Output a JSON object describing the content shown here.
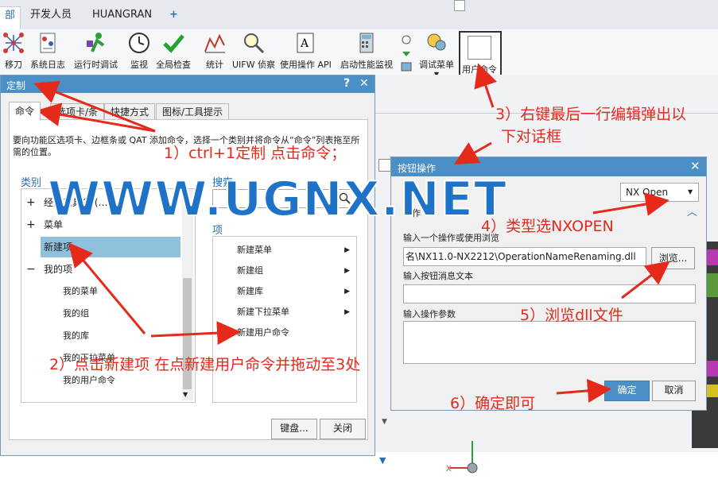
{
  "ribbon_tabs": [
    "部",
    "开发人员",
    "HUANGRAN",
    "+"
  ],
  "ribbon_buttons": [
    {
      "label": "移刀",
      "icon": "network-icon"
    },
    {
      "label": "系统日志",
      "icon": "log-icon"
    },
    {
      "label": "运行时调试",
      "icon": "debug-run-icon"
    },
    {
      "label": "监视",
      "icon": "clock-icon"
    },
    {
      "label": "全局检查",
      "icon": "check-icon"
    },
    {
      "label": "统计",
      "icon": "chart-icon"
    },
    {
      "label": "UIFW 侦察",
      "icon": "magnifier-icon"
    },
    {
      "label": "使用操作 API",
      "icon": "api-doc-icon"
    },
    {
      "label": "启动性能监视",
      "icon": "calculator-icon"
    },
    {
      "label": "调试菜单",
      "icon": "debug-menu-icon"
    },
    {
      "label": "用户命令",
      "icon": "blank-command-icon"
    }
  ],
  "customize": {
    "title": "定制",
    "help": "?",
    "close": "✕",
    "tabs": [
      "命令",
      "选项卡/条",
      "快捷方式",
      "图标/工具提示"
    ],
    "description": "要向功能区选项卡、边框条或 QAT 添加命令，选择一个类别并将命令从“命令”列表拖至所需的位置。",
    "category_heading": "类别",
    "search_heading": "搜索",
    "items_heading": "项",
    "tree": [
      {
        "label": "经典工具条 (…",
        "indent": 1,
        "expander": "+"
      },
      {
        "label": "菜单",
        "indent": 1,
        "expander": "+"
      },
      {
        "label": "新建项",
        "indent": 1,
        "expander": ""
      },
      {
        "label": "我的项",
        "indent": 1,
        "expander": "−"
      },
      {
        "label": "我的菜单",
        "indent": 2,
        "expander": ""
      },
      {
        "label": "我的组",
        "indent": 2,
        "expander": ""
      },
      {
        "label": "我的库",
        "indent": 2,
        "expander": ""
      },
      {
        "label": "我的下拉菜单",
        "indent": 2,
        "expander": ""
      },
      {
        "label": "我的用户命令",
        "indent": 2,
        "expander": ""
      }
    ],
    "items": [
      {
        "label": "新建菜单",
        "arrow": "▶"
      },
      {
        "label": "新建组",
        "arrow": "▶"
      },
      {
        "label": "新建库",
        "arrow": "▶"
      },
      {
        "label": "新建下拉菜单",
        "arrow": "▶"
      },
      {
        "label": "新建用户命令",
        "arrow": ""
      }
    ],
    "keyboard_button": "键盘...",
    "close_button": "关闭"
  },
  "button_op": {
    "title": "按钮操作",
    "close": "✕",
    "type_value": "NX Open",
    "section_label": "作",
    "op_label": "输入一个操作或使用浏览",
    "op_value": "名\\NX11.0-NX2212\\OperationNameRenaming.dll",
    "browse_button": "浏览...",
    "msg_label": "输入按钮消息文本",
    "msg_value": "",
    "param_label": "输入操作参数",
    "param_value": "",
    "ok_button": "确定",
    "cancel_button": "取消"
  },
  "watermark": "WWW.UGNX.NET",
  "annotations": {
    "a1": "1）ctrl+1定制 点击命令；",
    "a2": "2）点击新建项 在点新建用户命令并拖动至3处",
    "a3_line1": "3）右键最后一行编辑弹出以",
    "a3_line2": "下对话框",
    "a4": "4）类型选NXOPEN",
    "a5": "5）浏览dll文件",
    "a6": "6）确定即可"
  },
  "colors": {
    "accent": "#4a8fc6",
    "annotation": "#e5291b",
    "watermark": "#1e73c8",
    "selection": "#8fc0dc"
  }
}
